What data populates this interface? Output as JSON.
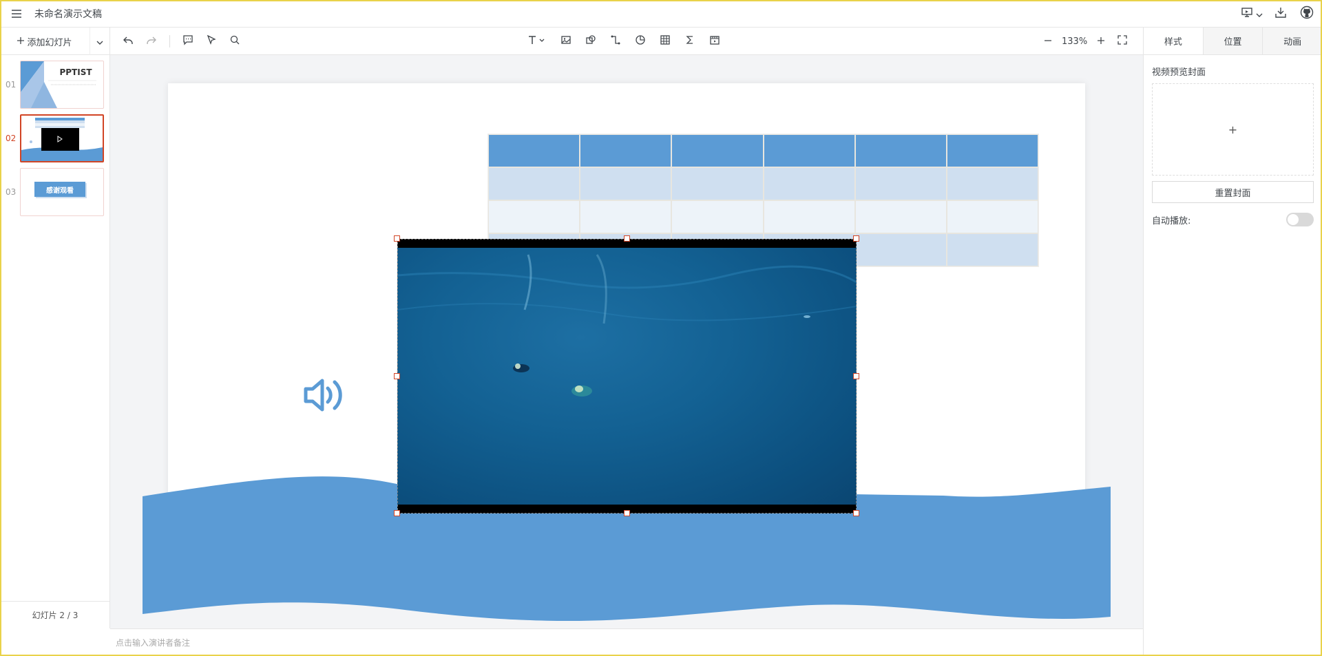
{
  "app": {
    "doc_title": "未命名演示文稿"
  },
  "toolbar": {
    "add_slide_label": "添加幻灯片",
    "zoom_level": "133%"
  },
  "thumbnails": [
    {
      "num": "01",
      "title": "PPTIST",
      "active": false
    },
    {
      "num": "02",
      "active": true
    },
    {
      "num": "03",
      "button_text": "感谢观看",
      "active": false
    }
  ],
  "pager": {
    "label": "幻灯片 2 / 3"
  },
  "notes": {
    "placeholder": "点击输入演讲者备注"
  },
  "right_panel": {
    "tabs": [
      "样式",
      "位置",
      "动画"
    ],
    "active_tab": "样式",
    "cover_label": "视频预览封面",
    "cover_add_symbol": "+",
    "reset_cover_label": "重置封面",
    "autoplay_label": "自动播放:",
    "autoplay_on": false
  },
  "colors": {
    "accent": "#d14424",
    "theme_blue": "#5b9bd5",
    "table_row_a": "#cfdff0",
    "table_row_b": "#edf3f9"
  }
}
